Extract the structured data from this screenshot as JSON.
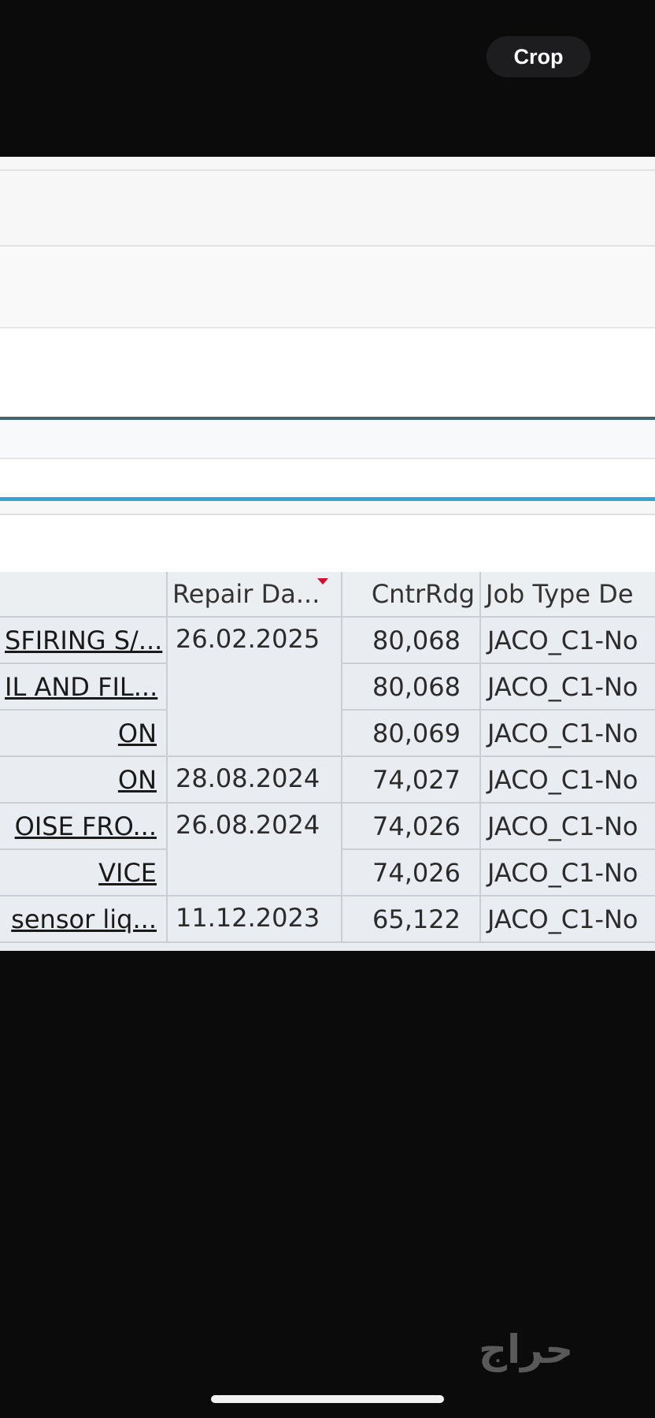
{
  "toolbar": {
    "crop_label": "Crop"
  },
  "table": {
    "headers": {
      "description": "",
      "repair_date": "Repair Da...",
      "counter_reading": "CntrRdg",
      "job_type": "Job Type De"
    },
    "rows": [
      {
        "description": "SFIRING S/...",
        "repair_date": "26.02.2025",
        "counter_reading": "80,068",
        "job_type": "JACO_C1-No"
      },
      {
        "description": "IL AND FIL...",
        "repair_date": "",
        "counter_reading": "80,068",
        "job_type": "JACO_C1-No"
      },
      {
        "description": "ON",
        "repair_date": "",
        "counter_reading": "80,069",
        "job_type": "JACO_C1-No"
      },
      {
        "description": "ON",
        "repair_date": "28.08.2024",
        "counter_reading": "74,027",
        "job_type": "JACO_C1-No"
      },
      {
        "description": "OISE FRO...",
        "repair_date": "26.08.2024",
        "counter_reading": "74,026",
        "job_type": "JACO_C1-No"
      },
      {
        "description": "VICE",
        "repair_date": "",
        "counter_reading": "74,026",
        "job_type": "JACO_C1-No"
      },
      {
        "description": "sensor liq...",
        "repair_date": "11.12.2023",
        "counter_reading": "65,122",
        "job_type": "JACO_C1-No"
      }
    ]
  },
  "watermark": {
    "text": "حراج"
  },
  "colors": {
    "accent_line": "#3aa3d6",
    "dark_line": "#3f6479",
    "sort_marker": "#d0102b"
  }
}
